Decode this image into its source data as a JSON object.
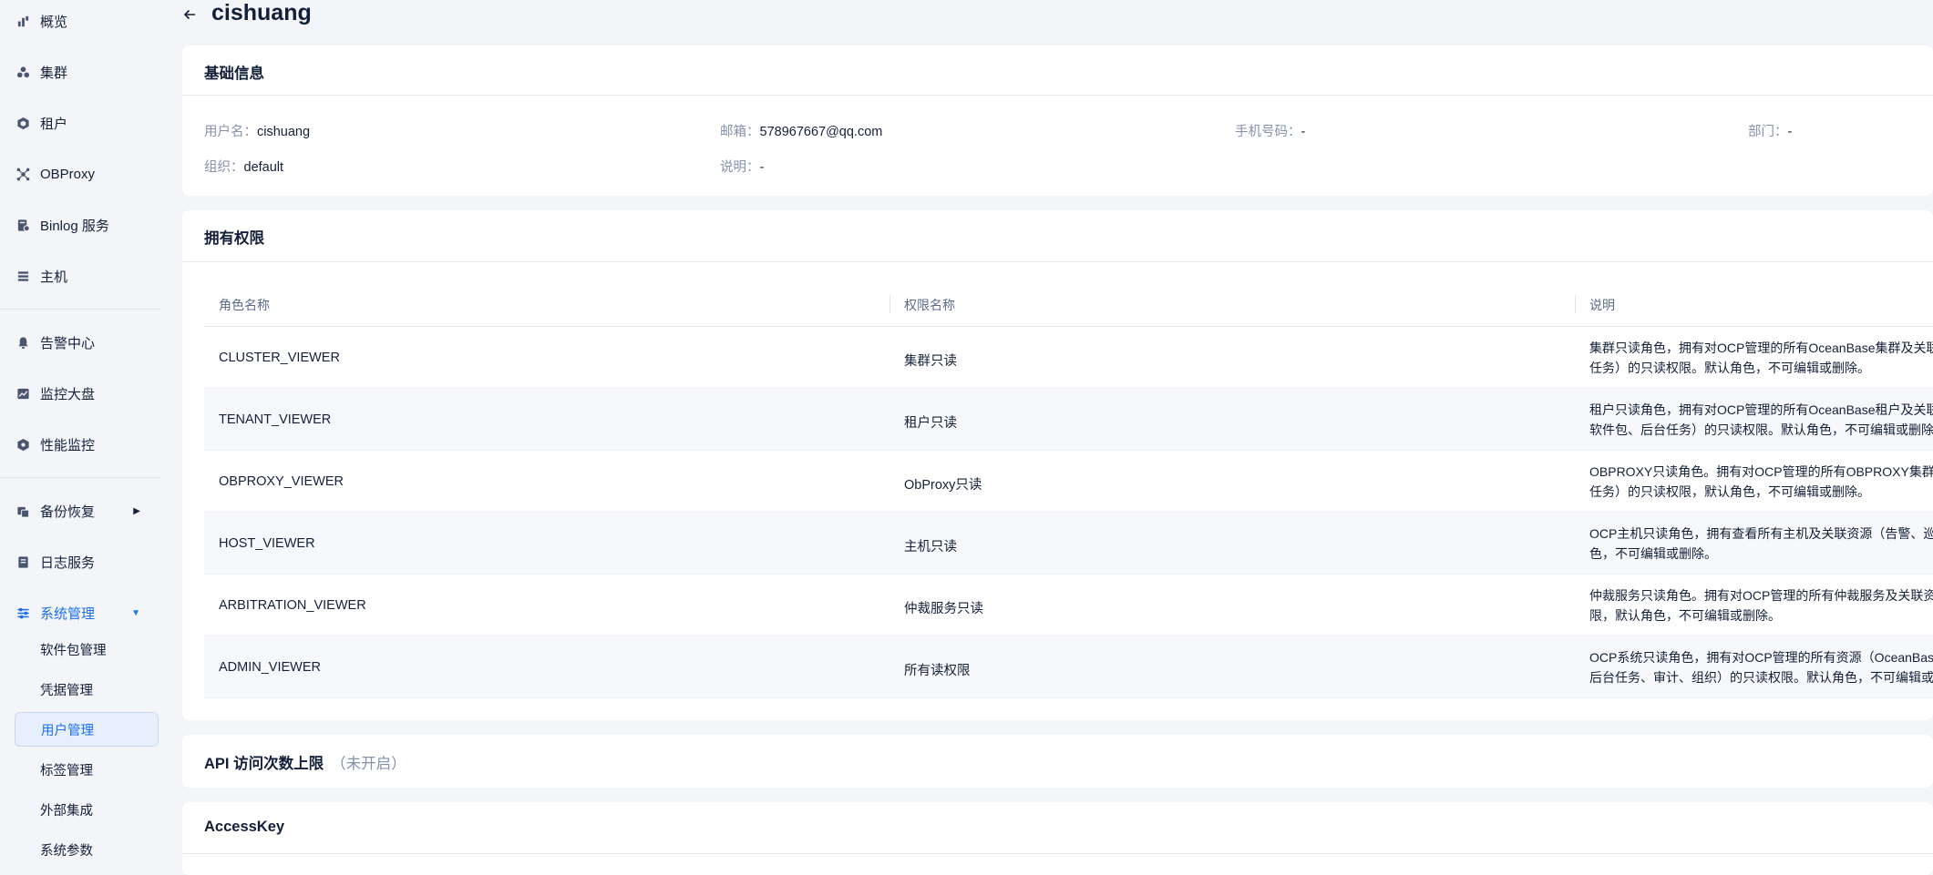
{
  "sidebar": {
    "items": [
      {
        "label": "概览",
        "icon": "bar-chart-icon"
      },
      {
        "label": "集群",
        "icon": "cluster-icon"
      },
      {
        "label": "租户",
        "icon": "tenant-icon"
      },
      {
        "label": "OBProxy",
        "icon": "proxy-icon"
      },
      {
        "label": "Binlog 服务",
        "icon": "binlog-icon"
      },
      {
        "label": "主机",
        "icon": "host-icon"
      },
      {
        "label": "告警中心",
        "icon": "bell-icon"
      },
      {
        "label": "监控大盘",
        "icon": "dashboard-icon"
      },
      {
        "label": "性能监控",
        "icon": "performance-icon"
      },
      {
        "label": "备份恢复",
        "icon": "backup-icon"
      },
      {
        "label": "日志服务",
        "icon": "log-icon"
      },
      {
        "label": "系统管理",
        "icon": "settings-icon"
      }
    ],
    "sub_items": [
      "软件包管理",
      "凭据管理",
      "用户管理",
      "标签管理",
      "外部集成",
      "系统参数"
    ]
  },
  "header": {
    "title": "cishuang"
  },
  "basic_info": {
    "title": "基础信息",
    "username_label": "用户名：",
    "username": "cishuang",
    "email_label": "邮箱：",
    "email": "578967667@qq.com",
    "phone_label": "手机号码：",
    "phone": "-",
    "dept_label": "部门：",
    "dept": "-",
    "org_label": "组织：",
    "org": "default",
    "desc_label": "说明：",
    "desc": "-"
  },
  "permissions": {
    "title": "拥有权限",
    "columns": [
      "角色名称",
      "权限名称",
      "说明"
    ],
    "rows": [
      {
        "role": "CLUSTER_VIEWER",
        "perm": "集群只读",
        "desc1": "集群只读角色，拥有对OCP管理的所有OceanBase集群及关联",
        "desc2": "任务）的只读权限。默认角色，不可编辑或删除。"
      },
      {
        "role": "TENANT_VIEWER",
        "perm": "租户只读",
        "desc1": "租户只读角色，拥有对OCP管理的所有OceanBase租户及关联",
        "desc2": "软件包、后台任务）的只读权限。默认角色，不可编辑或删除"
      },
      {
        "role": "OBPROXY_VIEWER",
        "perm": "ObProxy只读",
        "desc1": "OBPROXY只读角色。拥有对OCP管理的所有OBPROXY集群及",
        "desc2": "任务）的只读权限，默认角色，不可编辑或删除。"
      },
      {
        "role": "HOST_VIEWER",
        "perm": "主机只读",
        "desc1": "OCP主机只读角色，拥有查看所有主机及关联资源（告警、巡",
        "desc2": "色，不可编辑或删除。"
      },
      {
        "role": "ARBITRATION_VIEWER",
        "perm": "仲裁服务只读",
        "desc1": "仲裁服务只读角色。拥有对OCP管理的所有仲裁服务及关联资",
        "desc2": "限，默认角色，不可编辑或删除。"
      },
      {
        "role": "ADMIN_VIEWER",
        "perm": "所有读权限",
        "desc1": "OCP系统只读角色，拥有对OCP管理的所有资源（OceanBas",
        "desc2": "后台任务、审计、组织）的只读权限。默认角色，不可编辑或"
      }
    ]
  },
  "api_limit": {
    "title": "API 访问次数上限",
    "status": "（未开启）"
  },
  "access_key": {
    "title": "AccessKey"
  },
  "colors": {
    "accent": "#1a6ff0",
    "text": "#132039",
    "muted": "#8592ad",
    "bg": "#f3f5f9"
  }
}
